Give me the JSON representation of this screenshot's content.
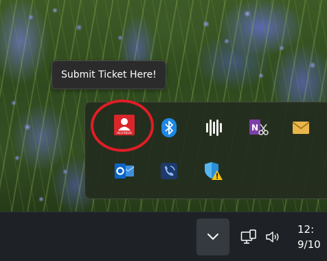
{
  "tooltip": {
    "text": "Submit Ticket Here!"
  },
  "tray_overflow": {
    "icons": [
      {
        "name": "helpdesk-icon",
        "label": "HELPDESK"
      },
      {
        "name": "bluetooth-icon"
      },
      {
        "name": "audio-waveform-icon"
      },
      {
        "name": "onenote-clipper-icon"
      },
      {
        "name": "mail-icon"
      },
      {
        "name": "outlook-icon"
      },
      {
        "name": "phone-app-icon"
      },
      {
        "name": "security-warning-icon"
      }
    ]
  },
  "taskbar": {
    "clock_time": "12:",
    "clock_date": "9/10",
    "icons": [
      "show-hidden-icons-chevron-icon",
      "network-icon",
      "volume-icon"
    ]
  },
  "colors": {
    "highlight_ring": "#e01d26",
    "helpdesk_red": "#d9262b",
    "bluetooth_blue": "#1e88e5",
    "mail_yellow": "#e8b64a",
    "taskbar": "#1e2226"
  }
}
